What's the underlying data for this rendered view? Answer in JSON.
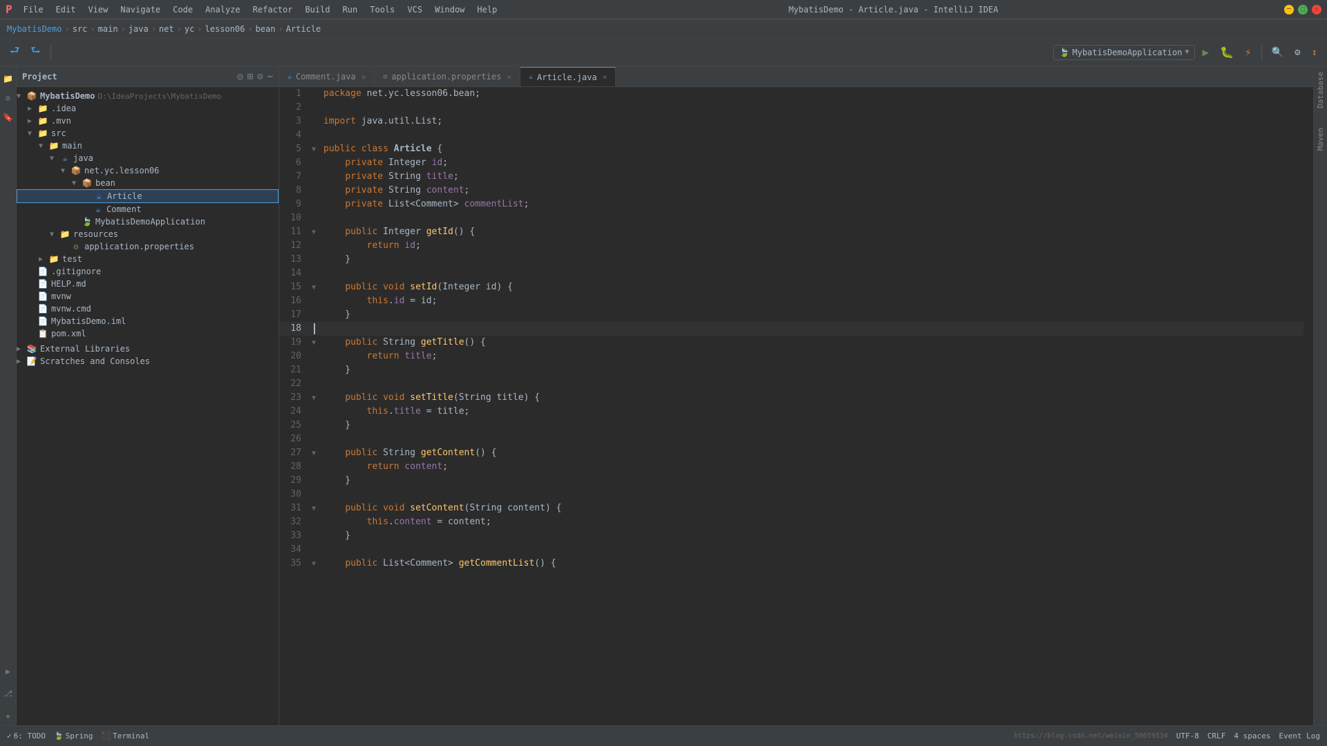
{
  "app": {
    "title": "MybatisDemo - Article.java - IntelliJ IDEA",
    "icon": "🅿"
  },
  "titlebar": {
    "menus": [
      "File",
      "Edit",
      "View",
      "Navigate",
      "Code",
      "Analyze",
      "Refactor",
      "Build",
      "Run",
      "Tools",
      "VCS",
      "Window",
      "Help"
    ],
    "min_label": "─",
    "max_label": "□",
    "close_label": "✕"
  },
  "breadcrumb": {
    "items": [
      "MybatisDemo",
      "src",
      "main",
      "java",
      "net",
      "yc",
      "lesson06",
      "bean",
      "Article"
    ]
  },
  "toolbar": {
    "run_config": "MybatisDemoApplication",
    "buttons": [
      "▶",
      "🐛",
      "⚡",
      "🔨",
      "↩",
      "↪",
      "⚙",
      "📊"
    ]
  },
  "tabs": [
    {
      "label": "Comment.java",
      "active": false,
      "icon": "☕",
      "color": "#4d9de0"
    },
    {
      "label": "application.properties",
      "active": false,
      "icon": "⚙",
      "color": "#6a8759"
    },
    {
      "label": "Article.java",
      "active": true,
      "icon": "☕",
      "color": "#4d9de0"
    }
  ],
  "sidebar": {
    "title": "Project",
    "root": {
      "label": "MybatisDemo",
      "path": "D:\\IdeaProjects\\MybatisDemo",
      "children": [
        {
          "label": ".idea",
          "type": "folder",
          "expanded": false
        },
        {
          "label": ".mvn",
          "type": "folder",
          "expanded": false
        },
        {
          "label": "src",
          "type": "folder",
          "expanded": true,
          "children": [
            {
              "label": "main",
              "type": "folder",
              "expanded": true,
              "children": [
                {
                  "label": "java",
                  "type": "folder",
                  "expanded": true,
                  "children": [
                    {
                      "label": "net.yc.lesson06",
                      "type": "package",
                      "expanded": true,
                      "children": [
                        {
                          "label": "bean",
                          "type": "package",
                          "expanded": true,
                          "children": [
                            {
                              "label": "Article",
                              "type": "class",
                              "selected": true
                            },
                            {
                              "label": "Comment",
                              "type": "class"
                            }
                          ]
                        },
                        {
                          "label": "MybatisDemoApplication",
                          "type": "class-spring"
                        }
                      ]
                    }
                  ]
                },
                {
                  "label": "resources",
                  "type": "folder",
                  "expanded": true,
                  "children": [
                    {
                      "label": "application.properties",
                      "type": "properties"
                    }
                  ]
                }
              ]
            },
            {
              "label": "test",
              "type": "folder",
              "expanded": false
            }
          ]
        },
        {
          "label": ".gitignore",
          "type": "file"
        },
        {
          "label": "HELP.md",
          "type": "file"
        },
        {
          "label": "mvnw",
          "type": "file"
        },
        {
          "label": "mvnw.cmd",
          "type": "file"
        },
        {
          "label": "MybatisDemo.iml",
          "type": "file"
        },
        {
          "label": "pom.xml",
          "type": "xml"
        }
      ]
    },
    "external_libraries": "External Libraries",
    "scratches": "Scratches and Consoles"
  },
  "code": {
    "filename": "Article.java",
    "lines": [
      {
        "n": 1,
        "text": "package net.yc.lesson06.bean;"
      },
      {
        "n": 2,
        "text": ""
      },
      {
        "n": 3,
        "text": "import java.util.List;"
      },
      {
        "n": 4,
        "text": ""
      },
      {
        "n": 5,
        "text": "public class Article {"
      },
      {
        "n": 6,
        "text": "    private Integer id;"
      },
      {
        "n": 7,
        "text": "    private String title;"
      },
      {
        "n": 8,
        "text": "    private String content;"
      },
      {
        "n": 9,
        "text": "    private List<Comment> commentList;"
      },
      {
        "n": 10,
        "text": ""
      },
      {
        "n": 11,
        "text": "    public Integer getId() {"
      },
      {
        "n": 12,
        "text": "        return id;"
      },
      {
        "n": 13,
        "text": "    }"
      },
      {
        "n": 14,
        "text": ""
      },
      {
        "n": 15,
        "text": "    public void setId(Integer id) {"
      },
      {
        "n": 16,
        "text": "        this.id = id;"
      },
      {
        "n": 17,
        "text": "    }"
      },
      {
        "n": 18,
        "text": ""
      },
      {
        "n": 19,
        "text": "    public String getTitle() {"
      },
      {
        "n": 20,
        "text": "        return title;"
      },
      {
        "n": 21,
        "text": "    }"
      },
      {
        "n": 22,
        "text": ""
      },
      {
        "n": 23,
        "text": "    public void setTitle(String title) {"
      },
      {
        "n": 24,
        "text": "        this.title = title;"
      },
      {
        "n": 25,
        "text": "    }"
      },
      {
        "n": 26,
        "text": ""
      },
      {
        "n": 27,
        "text": "    public String getContent() {"
      },
      {
        "n": 28,
        "text": "        return content;"
      },
      {
        "n": 29,
        "text": "    }"
      },
      {
        "n": 30,
        "text": ""
      },
      {
        "n": 31,
        "text": "    public void setContent(String content) {"
      },
      {
        "n": 32,
        "text": "        this.content = content;"
      },
      {
        "n": 33,
        "text": "    }"
      },
      {
        "n": 34,
        "text": ""
      },
      {
        "n": 35,
        "text": "    public List<Comment> getCommentList() {"
      }
    ]
  },
  "statusbar": {
    "todo": "6: TODO",
    "spring": "Spring",
    "terminal": "Terminal",
    "right_info": "https://blog.csdn.net/weixin_50659534",
    "encoding": "UTF-8",
    "line_sep": "CRLF",
    "indent": "4 spaces"
  },
  "right_panel": {
    "database_label": "Database",
    "maven_label": "Maven"
  },
  "activity_bar": {
    "icons": [
      "📁",
      "🔍",
      "🔀",
      "🐛",
      "⚙"
    ]
  }
}
